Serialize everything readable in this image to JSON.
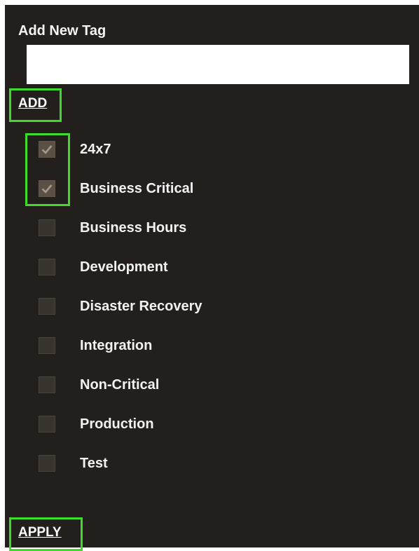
{
  "panel": {
    "title": "Add New Tag",
    "input": {
      "value": "",
      "placeholder": ""
    },
    "add_label": "ADD",
    "apply_label": "APPLY"
  },
  "tags": [
    {
      "label": "24x7",
      "checked": true
    },
    {
      "label": "Business Critical",
      "checked": true
    },
    {
      "label": "Business Hours",
      "checked": false
    },
    {
      "label": "Development",
      "checked": false
    },
    {
      "label": "Disaster Recovery",
      "checked": false
    },
    {
      "label": "Integration",
      "checked": false
    },
    {
      "label": "Non-Critical",
      "checked": false
    },
    {
      "label": "Production",
      "checked": false
    },
    {
      "label": "Test",
      "checked": false
    }
  ],
  "colors": {
    "panel_bg": "#231f1c",
    "highlight": "#3ddc2a",
    "checkbox_bg": "#3a342e",
    "checkbox_checked_bg": "#5a5045",
    "checkmark": "#a89a88"
  }
}
